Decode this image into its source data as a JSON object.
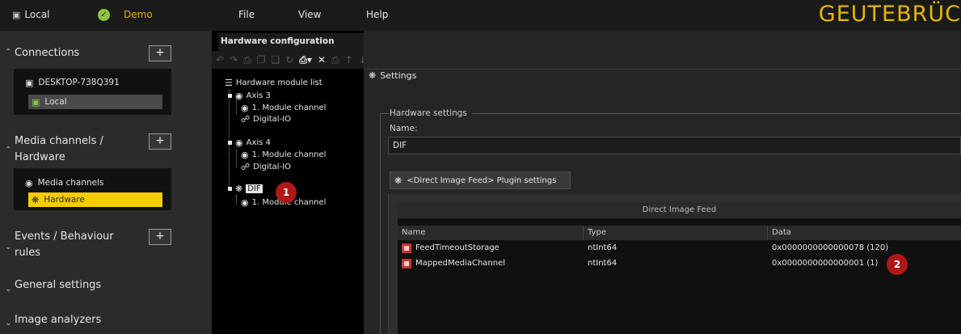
{
  "topbar": {
    "connection_label": "Local",
    "status_label": "Demo",
    "menu": [
      "File",
      "View",
      "Help"
    ],
    "brand": "GEUTEBRÜC"
  },
  "nav": {
    "connections": {
      "title": "Connections",
      "add": "+",
      "items": [
        "DESKTOP-738Q391",
        "Local"
      ]
    },
    "media": {
      "title_line1": "Media channels /",
      "title_line2": "Hardware",
      "add": "+",
      "items": [
        "Media channels",
        "Hardware"
      ]
    },
    "events": {
      "title_line1": "Events / Behaviour",
      "title_line2": "rules",
      "add": "+"
    },
    "general": {
      "title": "General settings"
    },
    "analyzers": {
      "title": "Image analyzers"
    }
  },
  "hardware": {
    "header": "Hardware configuration",
    "tree": {
      "root": "Hardware module list",
      "axis3": "Axis 3",
      "axis3_ch": "1. Module channel",
      "axis3_io": "Digital-IO",
      "axis4": "Axis 4",
      "axis4_ch": "1. Module channel",
      "axis4_io": "Digital-IO",
      "dif": "DIF",
      "dif_ch": "1. Module channel"
    }
  },
  "settings": {
    "tab": "Settings",
    "group": "Hardware settings",
    "name_label": "Name:",
    "name_value": "DIF",
    "plugin_button": "<Direct Image Feed> Plugin settings",
    "table": {
      "title": "Direct Image Feed",
      "columns": [
        "Name",
        "Type",
        "Data"
      ],
      "rows": [
        {
          "name": "FeedTimeoutStorage",
          "type": "ntInt64",
          "data": "0x0000000000000078 (120)"
        },
        {
          "name": "MappedMediaChannel",
          "type": "ntInt64",
          "data": "0x0000000000000001 (1)"
        }
      ]
    }
  },
  "badges": {
    "one": "1",
    "two": "2"
  },
  "colors": {
    "accent": "#f5cc00",
    "badge": "#b01717",
    "status_ok": "#8cc63f"
  }
}
